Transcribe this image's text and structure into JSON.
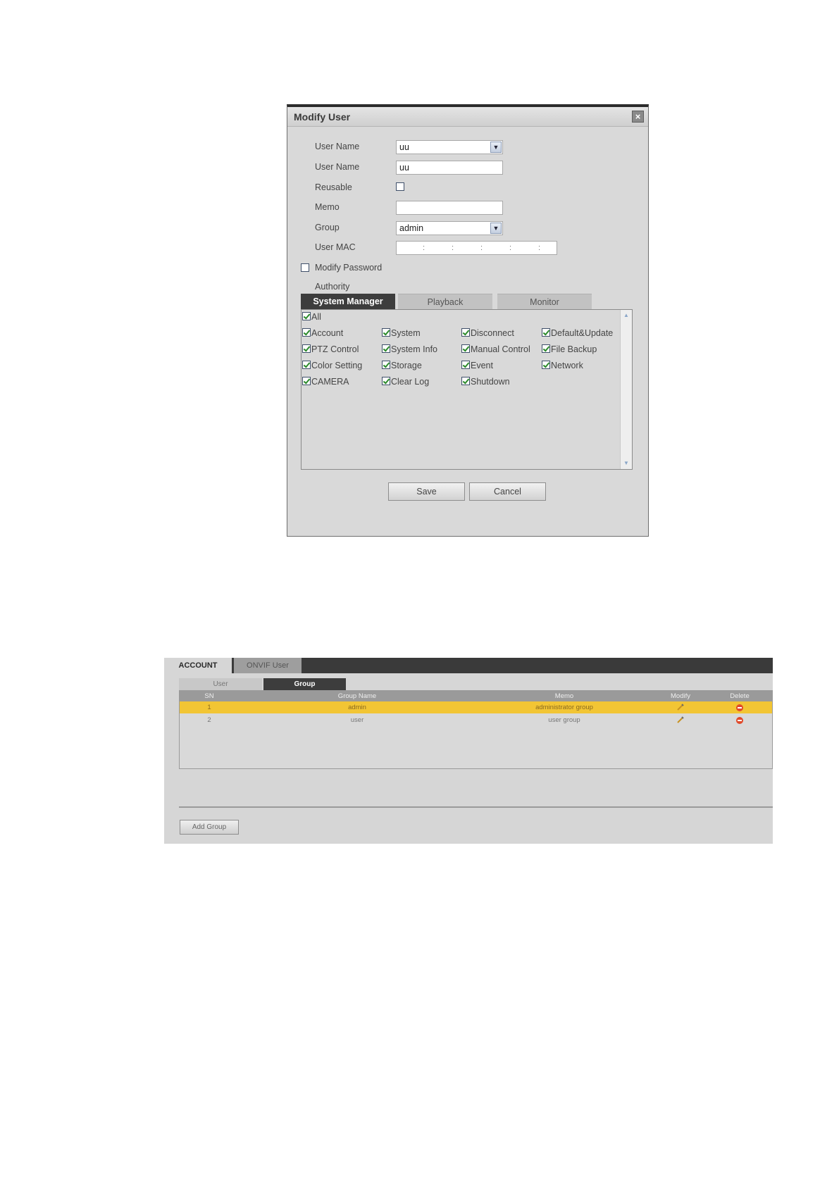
{
  "dialog": {
    "title": "Modify User",
    "close_glyph": "×",
    "fields": {
      "user_select_label": "User Name",
      "user_select_value": "uu",
      "user_name_label": "User Name",
      "user_name_value": "uu",
      "reusable_label": "Reusable",
      "memo_label": "Memo",
      "memo_value": "",
      "group_label": "Group",
      "group_value": "admin",
      "user_mac_label": "User MAC",
      "mac_separators": [
        ":",
        ":",
        ":",
        ":",
        ":"
      ],
      "modify_password_label": "Modify Password",
      "authority_label": "Authority"
    },
    "tabs": [
      "System Manager",
      "Playback",
      "Monitor"
    ],
    "permissions": {
      "all": "All",
      "rows": [
        [
          "Account",
          "System",
          "Disconnect",
          "Default&Update"
        ],
        [
          "PTZ Control",
          "System Info",
          "Manual Control",
          "File Backup"
        ],
        [
          "Color Setting",
          "Storage",
          "Event",
          "Network"
        ],
        [
          "CAMERA",
          "Clear Log",
          "Shutdown"
        ]
      ]
    },
    "buttons": {
      "save": "Save",
      "cancel": "Cancel"
    }
  },
  "account": {
    "tabs": [
      "ACCOUNT",
      "ONVIF User"
    ],
    "sub_tabs": [
      "User",
      "Group"
    ],
    "columns": [
      "SN",
      "Group Name",
      "Memo",
      "Modify",
      "Delete"
    ],
    "rows": [
      {
        "sn": "1",
        "name": "admin",
        "memo": "administrator group"
      },
      {
        "sn": "2",
        "name": "user",
        "memo": "user group"
      }
    ],
    "add_group": "Add Group"
  },
  "colors": {
    "selected_row": "#f2c534",
    "dark_tab": "#3d3d3d",
    "check": "#2a8a2a",
    "delete": "#e14a2a"
  }
}
